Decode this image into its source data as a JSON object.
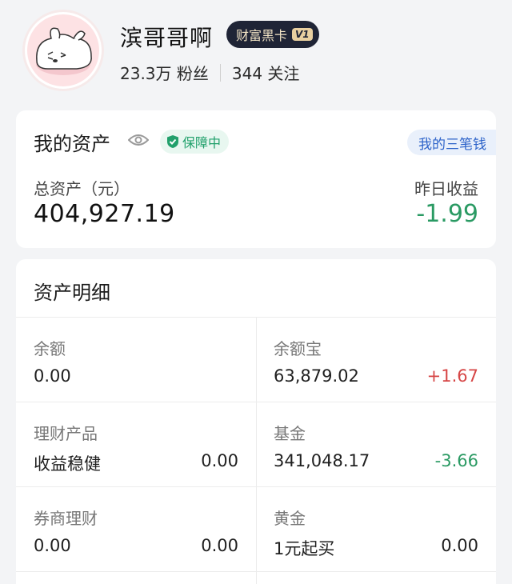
{
  "profile": {
    "name": "滨哥哥啊",
    "badge": "财富黑卡",
    "badge_level": "V1",
    "fans": "23.3万 粉丝",
    "follows": "344 关注"
  },
  "summary": {
    "title": "我的资产",
    "protect": "保障中",
    "three_money": "我的三笔钱",
    "total_label": "总资产（元）",
    "total_value": "404,927.19",
    "yday_label": "昨日收益",
    "yday_value": "-1.99"
  },
  "detail": {
    "title": "资产明细",
    "cells": [
      {
        "label": "余额",
        "sub": "0.00",
        "value": ""
      },
      {
        "label": "余额宝",
        "sub": "63,879.02",
        "value": "+1.67"
      },
      {
        "label": "理财产品",
        "sub": "收益稳健",
        "value": "0.00"
      },
      {
        "label": "基金",
        "sub": "341,048.17",
        "value": "-3.66"
      },
      {
        "label": "券商理财",
        "sub": "0.00",
        "value": "0.00"
      },
      {
        "label": "黄金",
        "sub": "1元起买",
        "value": "0.00"
      }
    ]
  },
  "colors": {
    "accent_green": "#2a9a63",
    "accent_red": "#d64545",
    "accent_blue": "#2d63c9",
    "vip_bg": "#1f2436"
  },
  "icons": [
    "avatar-image",
    "eye-icon",
    "shield-check-icon"
  ]
}
